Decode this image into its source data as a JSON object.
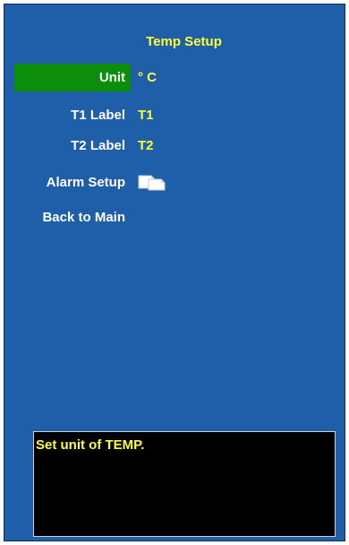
{
  "screen": {
    "title": "Temp Setup",
    "colors": {
      "background": "#1f5ea8",
      "selected_row": "#0b8f0b",
      "value_text": "#ffff33",
      "label_text": "#ffffff",
      "help_background": "#000000"
    }
  },
  "menu": {
    "items": [
      {
        "label": "Unit",
        "value": "° C",
        "selected": true
      },
      {
        "label": "T1 Label",
        "value": "T1",
        "selected": false
      },
      {
        "label": "T2 Label",
        "value": "T2",
        "selected": false
      },
      {
        "label": "Alarm Setup",
        "value_icon": "submenu-pages-icon",
        "selected": false
      },
      {
        "label": "Back to Main",
        "selected": false
      }
    ]
  },
  "help": {
    "text": "Set unit of TEMP."
  }
}
